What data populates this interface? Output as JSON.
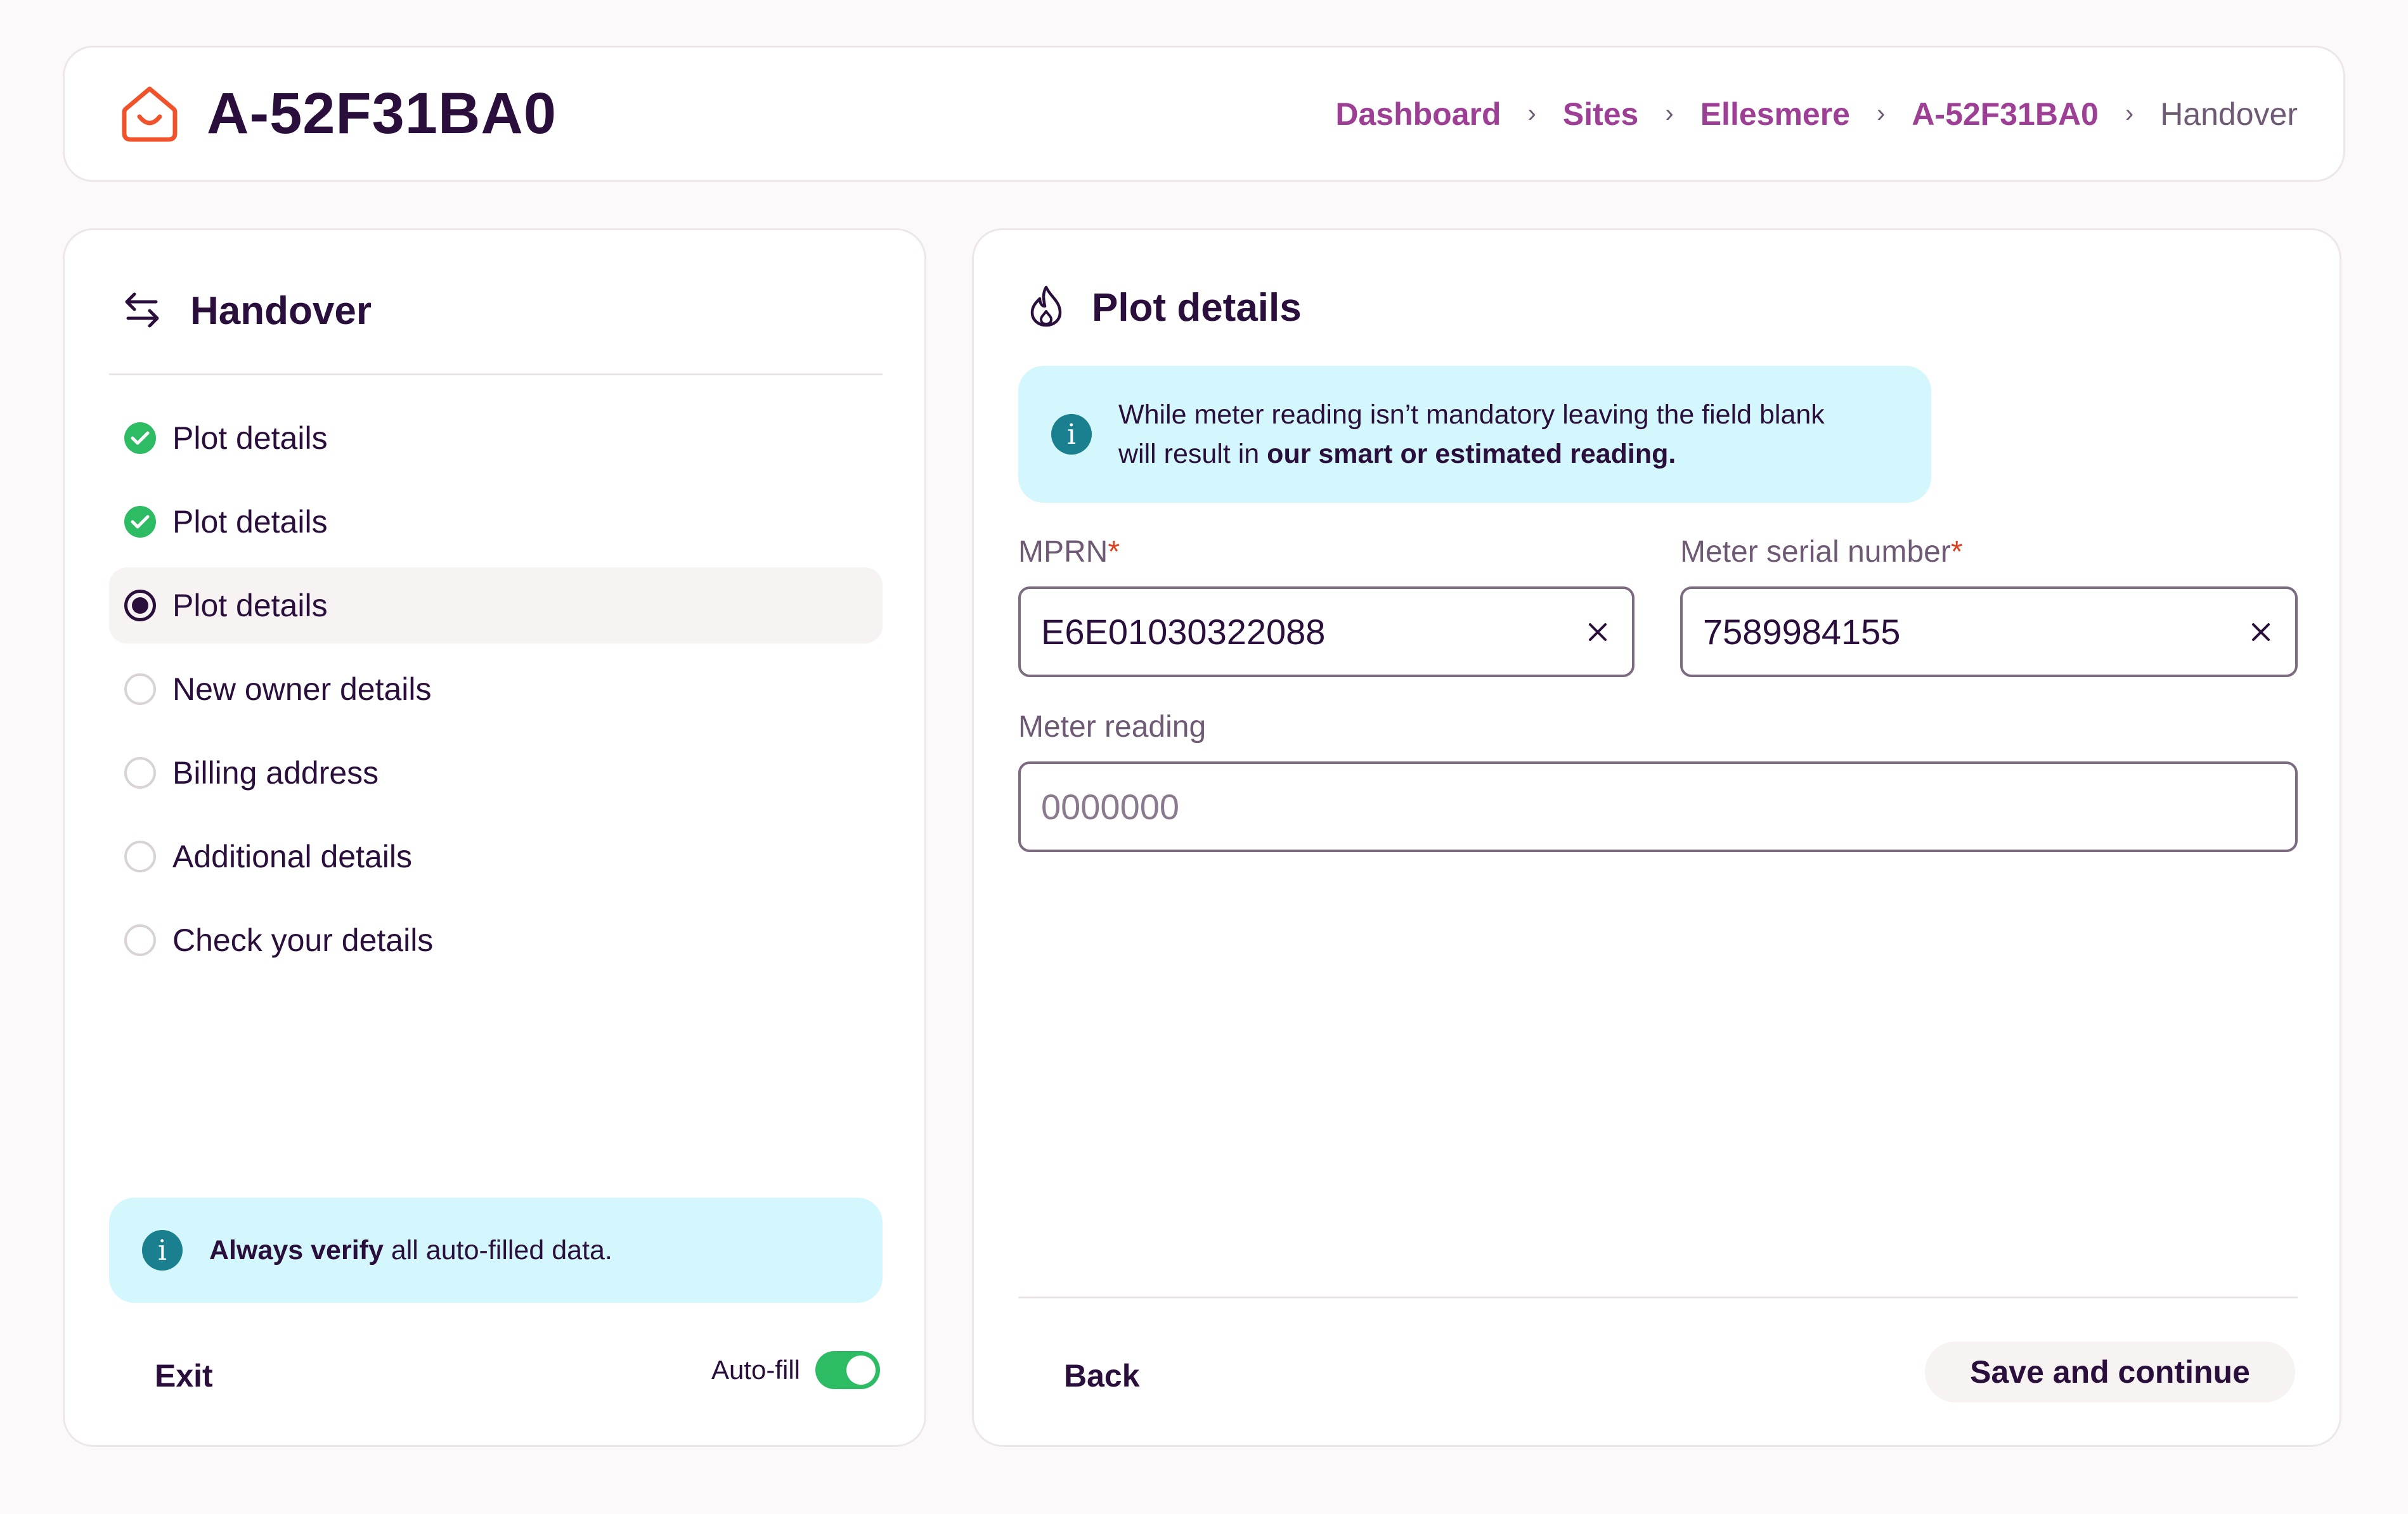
{
  "header": {
    "title": "A-52F31BA0",
    "logo_icon": "house-smile-icon",
    "breadcrumb": [
      {
        "label": "Dashboard",
        "link": true
      },
      {
        "label": "Sites",
        "link": true
      },
      {
        "label": "Ellesmere",
        "link": true
      },
      {
        "label": "A-52F31BA0",
        "link": true
      },
      {
        "label": "Handover",
        "link": false
      }
    ]
  },
  "sidebar": {
    "title": "Handover",
    "title_icon": "swap-arrows-icon",
    "steps": [
      {
        "label": "Plot details",
        "status": "done"
      },
      {
        "label": "Plot details",
        "status": "done"
      },
      {
        "label": "Plot details",
        "status": "current"
      },
      {
        "label": "New owner details",
        "status": "pending"
      },
      {
        "label": "Billing address",
        "status": "pending"
      },
      {
        "label": "Additional details",
        "status": "pending"
      },
      {
        "label": "Check your details",
        "status": "pending"
      }
    ],
    "notice": {
      "bold": "Always verify",
      "text": " all auto-filled data."
    },
    "exit_label": "Exit",
    "autofill_label": "Auto-fill",
    "autofill_on": true
  },
  "main": {
    "title": "Plot details",
    "title_icon": "flame-icon",
    "info": {
      "line1": "While meter reading isn’t mandatory leaving the field blank",
      "line2_prefix": "will result in ",
      "line2_bold": "our smart or estimated reading."
    },
    "fields": {
      "mprn": {
        "label": "MPRN",
        "required": "*",
        "value": "E6E01030322088"
      },
      "serial": {
        "label": "Meter serial number",
        "required": "*",
        "value": "7589984155"
      },
      "reading": {
        "label": "Meter reading",
        "value": "",
        "placeholder": "0000000"
      }
    },
    "back_label": "Back",
    "save_label": "Save and continue"
  },
  "colors": {
    "accent_purple": "#9c3f95",
    "text_dark": "#2a0f3c",
    "success_green": "#2dbb63",
    "info_bg": "#d3f7fd",
    "logo_orange": "#f0532b"
  }
}
